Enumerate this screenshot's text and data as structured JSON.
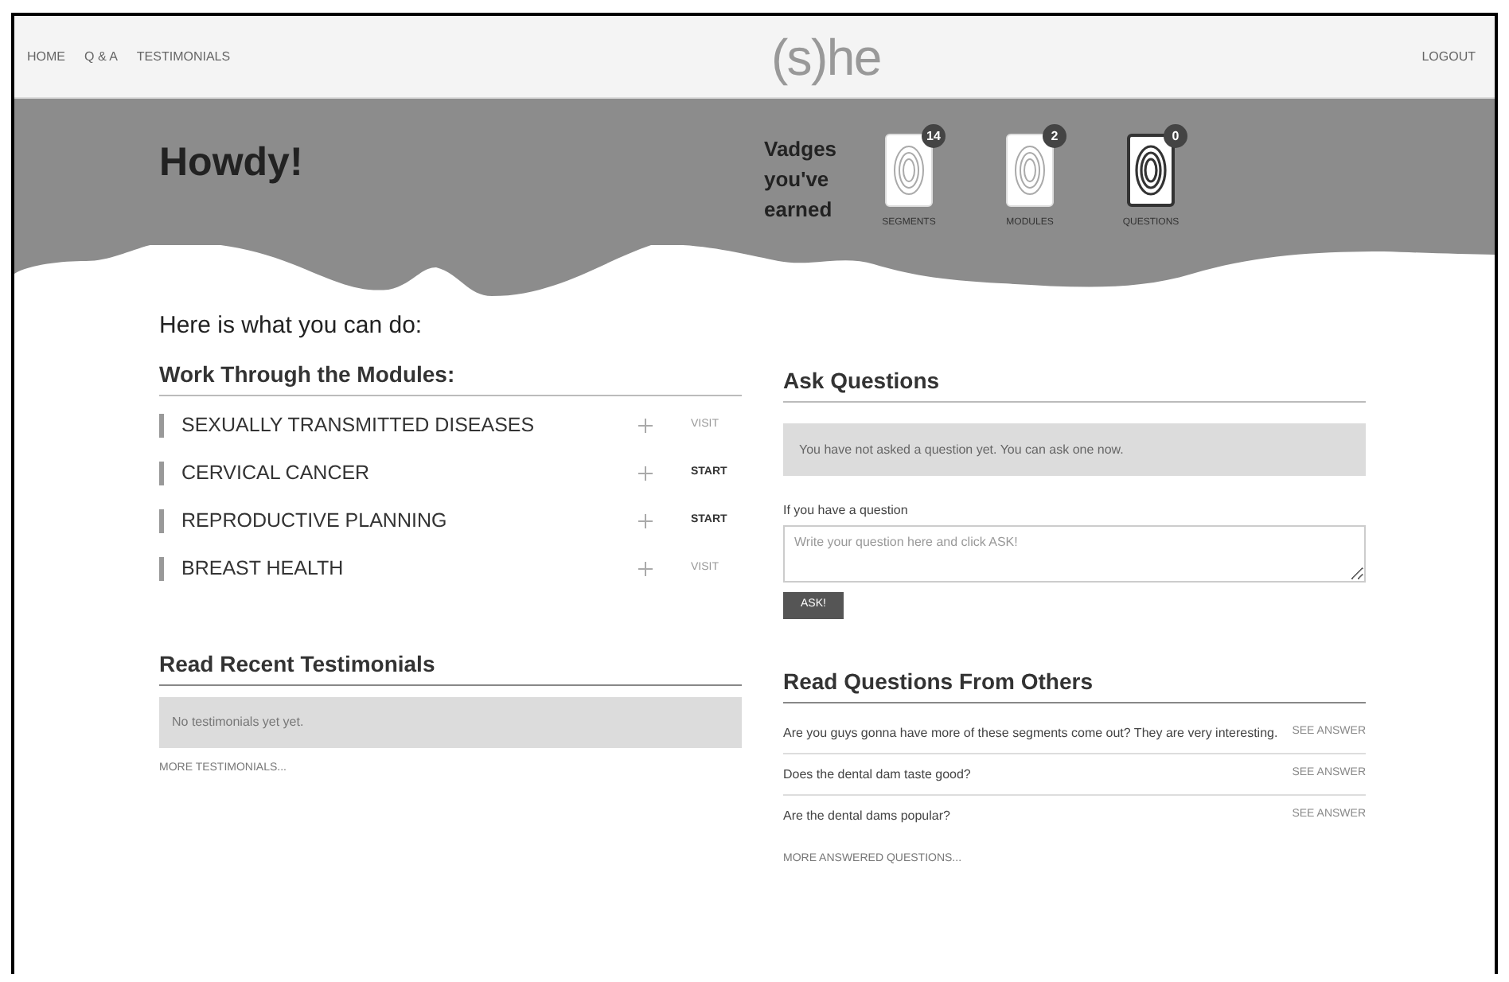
{
  "nav": {
    "links": [
      "HOME",
      "Q & A",
      "TESTIMONIALS"
    ],
    "logo": "(s)he",
    "logout": "LOGOUT"
  },
  "hero": {
    "greeting": "Howdy!",
    "badges_title": "Vadges you've earned",
    "badges": [
      {
        "label": "SEGMENTS",
        "count": "14",
        "highlighted": false
      },
      {
        "label": "MODULES",
        "count": "2",
        "highlighted": false
      },
      {
        "label": "QUESTIONS",
        "count": "0",
        "highlighted": true
      }
    ]
  },
  "intro": "Here is what you can do:",
  "modules": {
    "title": "Work Through the Modules:",
    "items": [
      {
        "name": "SEXUALLY TRANSMITTED DISEASES",
        "action": "VISIT",
        "emphasized": false
      },
      {
        "name": "CERVICAL CANCER",
        "action": "START",
        "emphasized": true
      },
      {
        "name": "REPRODUCTIVE PLANNING",
        "action": "START",
        "emphasized": true
      },
      {
        "name": "BREAST HEALTH",
        "action": "VISIT",
        "emphasized": false
      }
    ]
  },
  "testimonials": {
    "title": "Read Recent Testimonials",
    "notice": "No testimonials yet yet.",
    "more": "MORE TESTIMONIALS..."
  },
  "ask": {
    "title": "Ask Questions",
    "notice": "You have not asked a question yet. You can ask one now.",
    "label": "If you have a question",
    "placeholder": "Write your question here and click ASK!",
    "button": "ASK!"
  },
  "others": {
    "title": "Read Questions From Others",
    "items": [
      {
        "question": "Are you guys gonna have more of these segments come out? They are very interesting.",
        "link": "SEE ANSWER"
      },
      {
        "question": "Does the dental dam taste good?",
        "link": "SEE ANSWER"
      },
      {
        "question": "Are the dental dams popular?",
        "link": "SEE ANSWER"
      }
    ],
    "more": "MORE ANSWERED QUESTIONS..."
  }
}
